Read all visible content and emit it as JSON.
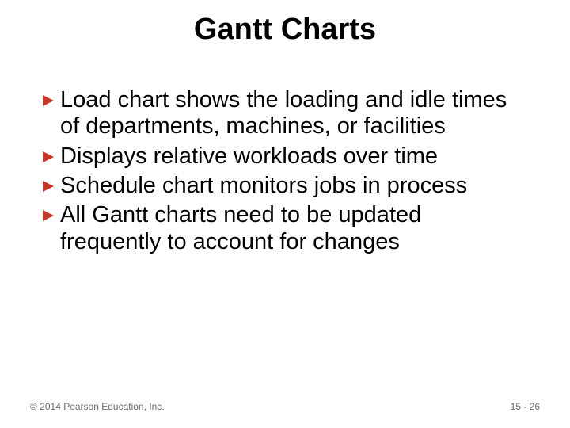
{
  "title": "Gantt Charts",
  "bullets": {
    "b1": "Load chart shows the loading and idle times of departments, machines, or facilities",
    "b2": "Displays relative workloads over time",
    "b3": "Schedule chart monitors jobs in process",
    "b4": "All Gantt charts need to be updated frequently to account for changes"
  },
  "footer": {
    "copyright": "© 2014 Pearson Education, Inc.",
    "page": "15 - 26"
  },
  "style": {
    "bullet_color": "#c0392b"
  }
}
